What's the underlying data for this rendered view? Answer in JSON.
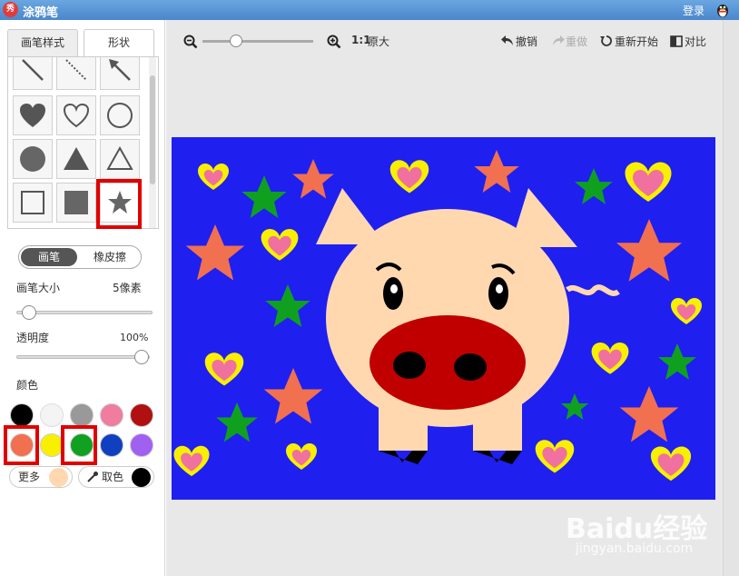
{
  "titlebar": {
    "logo": "秀",
    "title": "涂鸦笔",
    "login": "登录",
    "login_icon": "qq-penguin-icon"
  },
  "tabs": [
    {
      "label": "画笔样式"
    },
    {
      "label": "形状"
    }
  ],
  "shapes": [
    {
      "name": "line-icon"
    },
    {
      "name": "dashed-line-icon"
    },
    {
      "name": "arrow-icon"
    },
    {
      "name": "heart-filled-icon"
    },
    {
      "name": "heart-outline-icon"
    },
    {
      "name": "circle-outline-icon"
    },
    {
      "name": "circle-filled-icon"
    },
    {
      "name": "triangle-filled-icon"
    },
    {
      "name": "triangle-outline-icon"
    },
    {
      "name": "square-outline-icon"
    },
    {
      "name": "square-filled-icon"
    },
    {
      "name": "star-filled-icon",
      "selected": true
    }
  ],
  "brush_mode": {
    "pen": "画笔",
    "eraser": "橡皮擦",
    "active": "pen"
  },
  "brush_size": {
    "label": "画笔大小",
    "value": "5像素",
    "level": 0.05
  },
  "opacity": {
    "label": "透明度",
    "value": "100%",
    "level": 1.0
  },
  "colors": {
    "label": "颜色",
    "palette": [
      "#000000",
      "#f4f4f4",
      "#999999",
      "#f07ca0",
      "#b01010",
      "#f07050",
      "#f8f000",
      "#12a020",
      "#1040c0",
      "#a060f0"
    ],
    "highlighted": [
      "#f07050",
      "#12a020"
    ],
    "more_label": "更多",
    "current": "#ffd8b0",
    "pick_label": "取色",
    "pick_icon": "eyedropper-icon",
    "picked": "#000000"
  },
  "toolbar": {
    "zoom_out_icon": "zoom-out-icon",
    "zoom_in_icon": "zoom-in-icon",
    "zoom_level": 0.3,
    "actual_size": "1:1",
    "actual_size_label": "原大",
    "undo": "撤销",
    "redo": "重做",
    "restart": "重新开始",
    "compare": "对比"
  },
  "canvas": {
    "background": "#1f1ff0",
    "watermark_main": "Baidu经验",
    "watermark_sub": "jingyan.baidu.com"
  }
}
